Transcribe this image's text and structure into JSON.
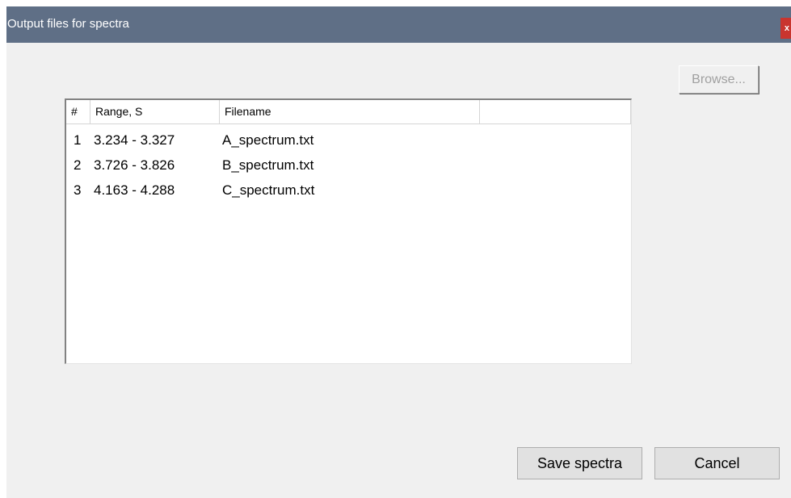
{
  "window": {
    "title": "Output files for spectra",
    "close_label": "x"
  },
  "browse_button": {
    "label": "Browse..."
  },
  "list": {
    "columns": [
      "#",
      "Range, S",
      "Filename",
      ""
    ],
    "rows": [
      {
        "num": "1",
        "range": "3.234 - 3.327",
        "filename": "A_spectrum.txt"
      },
      {
        "num": "2",
        "range": "3.726 - 3.826",
        "filename": "B_spectrum.txt"
      },
      {
        "num": "3",
        "range": "4.163 - 4.288",
        "filename": "C_spectrum.txt"
      }
    ]
  },
  "buttons": {
    "save_label": "Save spectra",
    "cancel_label": "Cancel"
  },
  "colors": {
    "titlebar": "#5f6f86",
    "close": "#c9352f",
    "dialog_bg": "#f0f0f0"
  }
}
